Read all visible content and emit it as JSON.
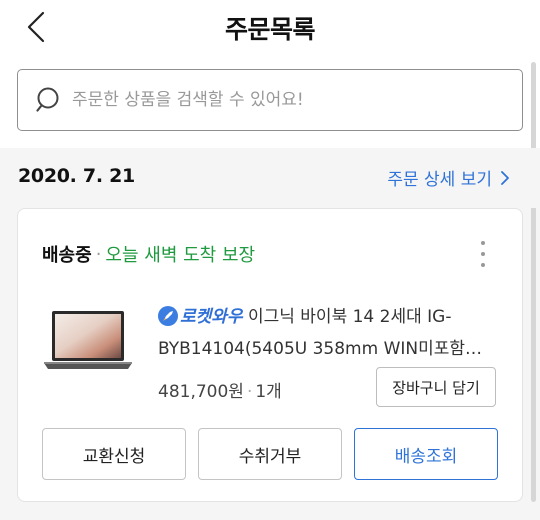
{
  "header": {
    "title": "주문목록",
    "back_icon": "chevron-left-icon"
  },
  "search": {
    "placeholder": "주문한 상품을 검색할 수 있어요!",
    "icon": "search-icon"
  },
  "order": {
    "date": "2020. 7. 21",
    "detail_link": "주문 상세 보기",
    "status": "배송중",
    "status_note": "오늘 새벽 도착 보장",
    "status_separator": "·",
    "product": {
      "badge": "로켓와우",
      "name": "이그닉 바이북 14 2세대 IG-BYB14104(5405U 358mm WIN미포함…",
      "price": "481,700원",
      "quantity": "1개",
      "separator": "·"
    },
    "cart_button": "장바구니 담기",
    "actions": {
      "exchange": "교환신청",
      "refuse": "수취거부",
      "track": "배송조회"
    }
  },
  "colors": {
    "accent_blue": "#2f73d9",
    "status_green": "#1f9a3e"
  }
}
